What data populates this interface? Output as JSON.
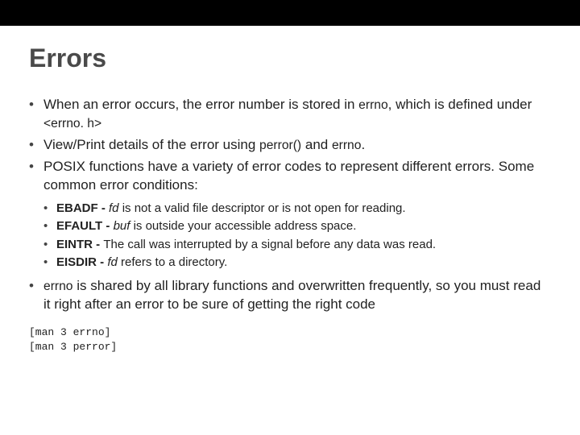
{
  "title": "Errors",
  "bullets": {
    "b1": {
      "pre": "When an error occurs, the error number is stored in ",
      "errno": "errno",
      "mid": ", which is defined under ",
      "hdr": "<errno. h>"
    },
    "b2": {
      "pre": "View/Print details of the error using ",
      "perror": "perror()",
      "mid": " and ",
      "errno": "errno",
      "post": "."
    },
    "b3": "POSIX functions have a variety of error codes to represent different errors. Some common error conditions:",
    "sub": [
      {
        "code": "EBADF",
        "sep": " - ",
        "desc_pre_i": "fd",
        "desc_rest": " is not a valid file descriptor or is not open for reading."
      },
      {
        "code": "EFAULT",
        "sep": " - ",
        "desc_pre_i": "buf",
        "desc_rest": " is outside your accessible address space."
      },
      {
        "code": "EINTR",
        "sep": " - ",
        "desc_plain": "The call was interrupted by a signal before any data was read."
      },
      {
        "code": "EISDIR",
        "sep": " - ",
        "desc_pre_i": "fd",
        "desc_rest": " refers to a directory."
      }
    ],
    "b4": {
      "errno": "errno",
      "rest": " is shared by all library functions and overwritten frequently, so you must read it right after an error to be sure of getting the right code"
    }
  },
  "mono": {
    "l1": "[man 3 errno]",
    "l2": "[man 3 perror]"
  }
}
